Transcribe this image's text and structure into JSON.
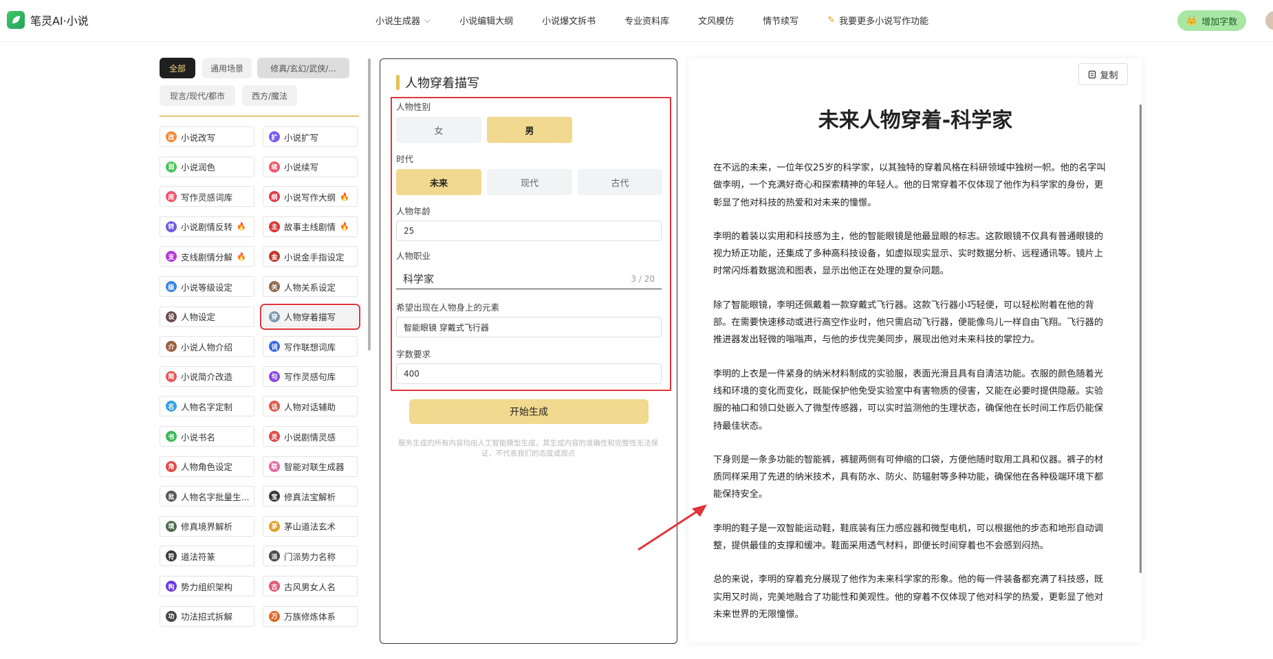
{
  "brand": {
    "name": "笔灵AI·小说"
  },
  "nav": [
    {
      "label": "小说生成器",
      "dropdown": true
    },
    {
      "label": "小说编辑大纲"
    },
    {
      "label": "小说爆文拆书"
    },
    {
      "label": "专业资料库"
    },
    {
      "label": "文风模仿"
    },
    {
      "label": "情节续写"
    },
    {
      "label": "我要更多小说写作功能",
      "icon": "pencil-icon"
    }
  ],
  "topup": {
    "label": "增加字数"
  },
  "filters": [
    {
      "label": "全部",
      "active": true
    },
    {
      "label": "通用场景"
    },
    {
      "label": "修真/玄幻/武侠/..."
    },
    {
      "label": "现言/现代/都市"
    },
    {
      "label": "西方/魔法"
    }
  ],
  "tools": [
    {
      "label": "小说改写",
      "icon": "改",
      "color": "#f28b3c"
    },
    {
      "label": "小说扩写",
      "icon": "扩",
      "color": "#7a5cf0"
    },
    {
      "label": "小说润色",
      "icon": "润",
      "color": "#4ac25b"
    },
    {
      "label": "小说续写",
      "icon": "续",
      "color": "#f0566b"
    },
    {
      "label": "写作灵感词库",
      "icon": "库",
      "color": "#f0566b"
    },
    {
      "label": "小说写作大纲",
      "icon": "纲",
      "color": "#e03a4a",
      "hot": true
    },
    {
      "label": "小说剧情反转",
      "icon": "转",
      "color": "#6b5ce0",
      "hot": true
    },
    {
      "label": "故事主线剧情",
      "icon": "主",
      "color": "#d93838",
      "hot": true
    },
    {
      "label": "支线剧情分解",
      "icon": "支",
      "color": "#b43bd4",
      "hot": true
    },
    {
      "label": "小说金手指设定",
      "icon": "金",
      "color": "#c0392b"
    },
    {
      "label": "小说等级设定",
      "icon": "级",
      "color": "#3a86e0"
    },
    {
      "label": "人物关系设定",
      "icon": "关",
      "color": "#8a6a50"
    },
    {
      "label": "人物设定",
      "icon": "设",
      "color": "#6b4a4a"
    },
    {
      "label": "人物穿着描写",
      "icon": "穿",
      "color": "#7a9ab0",
      "selected": true
    },
    {
      "label": "小说人物介绍",
      "icon": "介",
      "color": "#9a6040"
    },
    {
      "label": "写作联想词库",
      "icon": "词",
      "color": "#3a6be0"
    },
    {
      "label": "小说简介改造",
      "icon": "简",
      "color": "#e05858"
    },
    {
      "label": "写作灵感句库",
      "icon": "句",
      "color": "#8a4ae0"
    },
    {
      "label": "人物名字定制",
      "icon": "名",
      "color": "#3aa0e0"
    },
    {
      "label": "人物对话辅助",
      "icon": "话",
      "color": "#e0584a"
    },
    {
      "label": "小说书名",
      "icon": "书",
      "color": "#3ab85a"
    },
    {
      "label": "小说剧情灵感",
      "icon": "灵",
      "color": "#e04a4a"
    },
    {
      "label": "人物角色设定",
      "icon": "角",
      "color": "#e04a4a"
    },
    {
      "label": "智能对联生成器",
      "icon": "联",
      "color": "#e06aa0"
    },
    {
      "label": "人物名字批量生...",
      "icon": "批",
      "color": "#555555"
    },
    {
      "label": "修真法宝解析",
      "icon": "宝",
      "color": "#3a3a3a"
    },
    {
      "label": "修真境界解析",
      "icon": "境",
      "color": "#4a6a4a"
    },
    {
      "label": "茅山道法玄术",
      "icon": "茅",
      "color": "#e0a02a"
    },
    {
      "label": "道法符篆",
      "icon": "符",
      "color": "#3a3a3a"
    },
    {
      "label": "门派势力名称",
      "icon": "派",
      "color": "#4a4a4a"
    },
    {
      "label": "势力组织架构",
      "icon": "构",
      "color": "#6a3ae0"
    },
    {
      "label": "古风男女人名",
      "icon": "古",
      "color": "#e05a7a"
    },
    {
      "label": "功法招式拆解",
      "icon": "功",
      "color": "#444444"
    },
    {
      "label": "万族修炼体系",
      "icon": "万",
      "color": "#e06a2a"
    }
  ],
  "form": {
    "title": "人物穿着描写",
    "gender_label": "人物性别",
    "gender_options": [
      "女",
      "男"
    ],
    "gender_selected": 1,
    "era_label": "时代",
    "era_options": [
      "未来",
      "现代",
      "古代"
    ],
    "era_selected": 0,
    "age_label": "人物年龄",
    "age_value": "25",
    "job_label": "人物职业",
    "job_value": "科学家",
    "job_counter": "3 / 20",
    "elements_label": "希望出现在人物身上的元素",
    "elements_value": "智能眼镜 穿戴式飞行器",
    "words_label": "字数要求",
    "words_value": "400",
    "generate": "开始生成",
    "disclaimer": "服务生成的所有内容均由人工智能模型生成，其生成内容的准确性和完整性无法保证，不代表我们的态度或观点"
  },
  "result": {
    "copy": "复制",
    "title": "未来人物穿着-科学家",
    "paragraphs": [
      "在不远的未来，一位年仅25岁的科学家，以其独特的穿着风格在科研领域中独树一帜。他的名字叫做李明，一个充满好奇心和探索精神的年轻人。他的日常穿着不仅体现了他作为科学家的身份，更彰显了他对科技的热爱和对未来的憧憬。",
      "李明的着装以实用和科技感为主，他的智能眼镜是他最显眼的标志。这款眼镜不仅具有普通眼镜的视力矫正功能，还集成了多种高科技设备，如虚拟现实显示、实时数据分析、远程通讯等。镜片上时常闪烁着数据流和图表，显示出他正在处理的复杂问题。",
      "除了智能眼镜，李明还佩戴着一款穿戴式飞行器。这款飞行器小巧轻便，可以轻松附着在他的背部。在需要快速移动或进行高空作业时，他只需启动飞行器，便能像鸟儿一样自由飞翔。飞行器的推进器发出轻微的嗡嗡声，与他的步伐完美同步，展现出他对未来科技的掌控力。",
      "李明的上衣是一件紧身的纳米材料制成的实验服，表面光滑且具有自清洁功能。衣服的颜色随着光线和环境的变化而变化，既能保护他免受实验室中有害物质的侵害，又能在必要时提供隐蔽。实验服的袖口和领口处嵌入了微型传感器，可以实时监测他的生理状态，确保他在长时间工作后仍能保持最佳状态。",
      "下身则是一条多功能的智能裤，裤腿两侧有可伸缩的口袋，方便他随时取用工具和仪器。裤子的材质同样采用了先进的纳米技术，具有防水、防火、防辐射等多种功能，确保他在各种极端环境下都能保持安全。",
      "李明的鞋子是一双智能运动鞋，鞋底装有压力感应器和微型电机，可以根据他的步态和地形自动调整，提供最佳的支撑和缓冲。鞋面采用透气材料，即便长时间穿着也不会感到闷热。",
      "总的来说，李明的穿着充分展现了他作为未来科学家的形象。他的每一件装备都充满了科技感，既实用又时尚，完美地融合了功能性和美观性。他的穿着不仅体现了他对科学的热爱，更彰显了他对未来世界的无限憧憬。"
    ]
  },
  "colors": {
    "accent": "#f1d98f",
    "highlight": "#e0343a",
    "dark_chip": "#1f1f1f"
  }
}
